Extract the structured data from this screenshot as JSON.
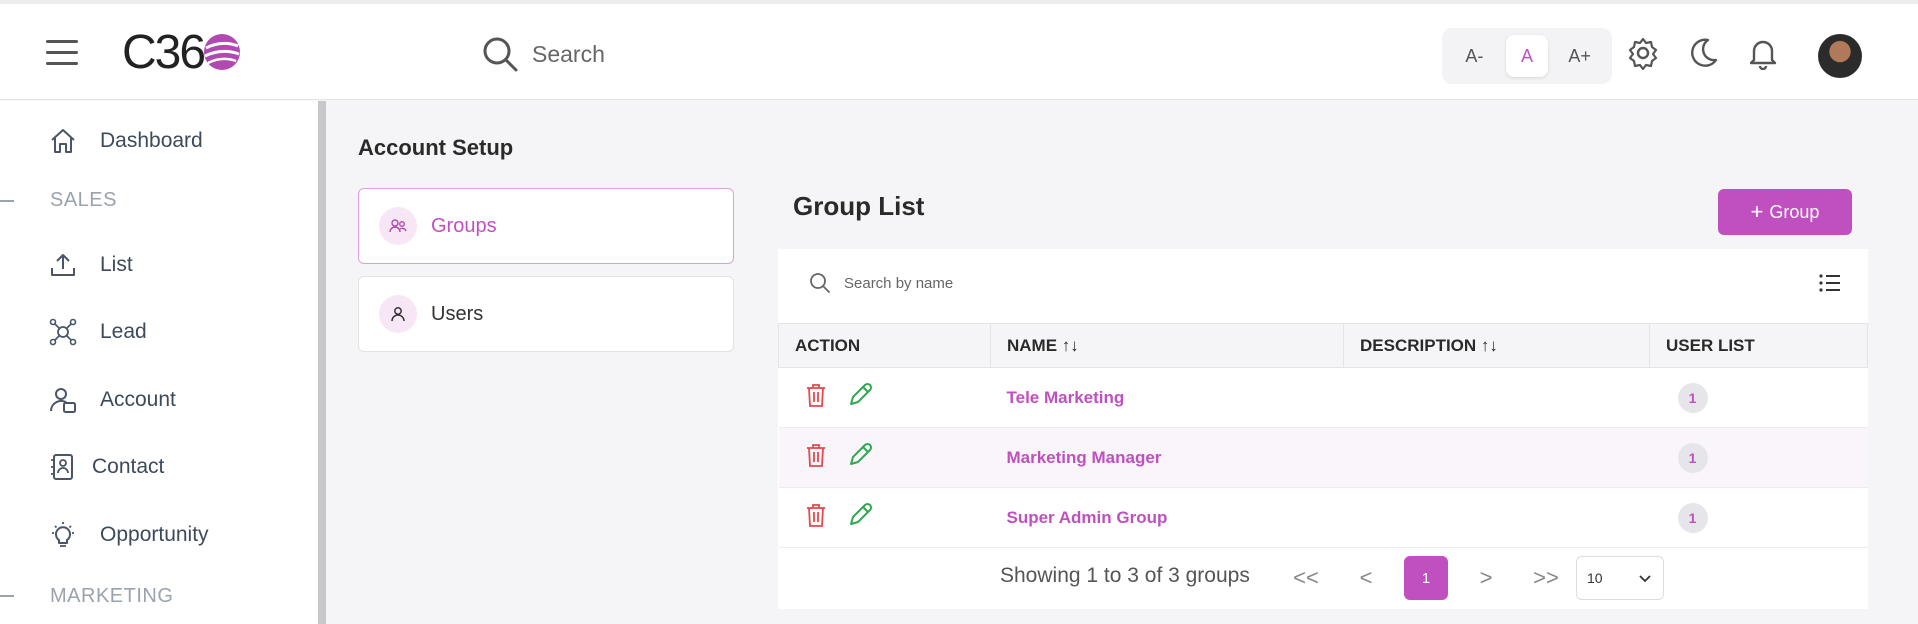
{
  "header": {
    "logo_text": "C36",
    "search_placeholder": "Search",
    "font_small": "A-",
    "font_normal": "A",
    "font_large": "A+"
  },
  "sidebar": {
    "items": [
      {
        "label": "Dashboard",
        "icon": "home-icon"
      },
      {
        "label": "List",
        "icon": "upload-icon"
      },
      {
        "label": "Lead",
        "icon": "network-icon"
      },
      {
        "label": "Account",
        "icon": "account-icon"
      },
      {
        "label": "Contact",
        "icon": "contact-icon"
      },
      {
        "label": "Opportunity",
        "icon": "bulb-icon"
      }
    ],
    "sections": [
      "SALES",
      "MARKETING"
    ]
  },
  "main": {
    "page_title": "Account Setup",
    "tabs": [
      {
        "label": "Groups",
        "icon": "users-group-icon",
        "active": true
      },
      {
        "label": "Users",
        "icon": "user-icon",
        "active": false
      }
    ],
    "list_title": "Group List",
    "add_button": "Group",
    "search_placeholder": "Search by name",
    "columns": [
      "ACTION",
      "NAME ↑↓",
      "DESCRIPTION ↑↓",
      "USER LIST"
    ],
    "rows": [
      {
        "name": "Tele Marketing",
        "description": "",
        "user_count": "1"
      },
      {
        "name": "Marketing Manager",
        "description": "",
        "user_count": "1"
      },
      {
        "name": "Super Admin Group",
        "description": "",
        "user_count": "1"
      }
    ],
    "pagination": {
      "summary": "Showing 1 to 3 of 3 groups",
      "first": "<<",
      "prev": "<",
      "current": "1",
      "next": ">",
      "last": ">>",
      "page_size": "10"
    }
  },
  "colors": {
    "accent": "#c050c0",
    "delete": "#e5484d",
    "edit": "#2fa84f"
  }
}
